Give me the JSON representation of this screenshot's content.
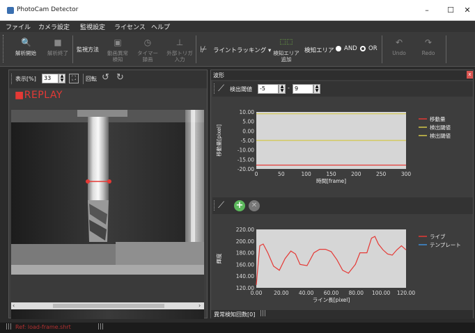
{
  "window": {
    "title": "PhotoCam Detector",
    "minimize": "–",
    "maximize": "☐",
    "close": "✕"
  },
  "menu": [
    "ファイル",
    "カメラ設定",
    "監視設定",
    "ライセンス",
    "ヘルプ"
  ],
  "toolbar": {
    "start_label": "解析開始",
    "stop_label": "解析終了",
    "monitor_method": "監視方法",
    "video_anomaly_l1": "動画異常",
    "video_anomaly_l2": "検知",
    "timer_l1": "タイマー",
    "timer_l2": "録画",
    "ext_trigger_l1": "外部トリガ",
    "ext_trigger_l2": "入力",
    "line_tracking": "ライントラッキング",
    "add_area_l1": "検知エリア",
    "add_area_l2": "追加",
    "detect_area": "検知エリア",
    "and_label": "AND",
    "or_label": "OR",
    "undo": "Undo",
    "redo": "Redo"
  },
  "left_panel": {
    "zoom_label": "表示[%]",
    "zoom_value": "33",
    "rotate_label": "回転",
    "replay_label": "■REPLAY"
  },
  "right_panel": {
    "title": "波形",
    "close": "x",
    "threshold_label": "検出閾値",
    "threshold_low": "-5",
    "threshold_sep": "-",
    "threshold_high": "9",
    "footer": "異常検知回数[0]"
  },
  "status": {
    "text": "Ref: load-frame.shrt"
  },
  "chart_data": [
    {
      "type": "line",
      "xlabel": "時間[frame]",
      "ylabel": "移動量[pixel]",
      "xlim": [
        0,
        300
      ],
      "ylim": [
        -20,
        10
      ],
      "xticks": [
        0,
        50,
        100,
        150,
        200,
        250,
        300
      ],
      "yticks": [
        "10.00",
        "5.00",
        "0.00",
        "-5.00",
        "-10.00",
        "-15.00",
        "-20.00"
      ],
      "series": [
        {
          "name": "移動量",
          "color": "#e53935",
          "x": [
            0,
            300
          ],
          "y": [
            -18,
            -18
          ]
        },
        {
          "name": "検出閾値",
          "color": "#d4c84a",
          "x": [
            0,
            300
          ],
          "y": [
            9,
            9
          ]
        },
        {
          "name": "検出閾値",
          "color": "#d4c84a",
          "x": [
            0,
            300
          ],
          "y": [
            -5,
            -5
          ]
        }
      ]
    },
    {
      "type": "line",
      "xlabel": "ライン長[pixel]",
      "ylabel": "輝度",
      "xlim": [
        0,
        130
      ],
      "ylim": [
        120,
        220
      ],
      "xticks": [
        "0.00",
        "20.00",
        "40.00",
        "60.00",
        "80.00",
        "100.00",
        "120.00"
      ],
      "yticks": [
        "220.00",
        "200.00",
        "180.00",
        "160.00",
        "140.00",
        "120.00"
      ],
      "series": [
        {
          "name": "ライブ",
          "color": "#e53935",
          "x": [
            0,
            3,
            6,
            10,
            15,
            20,
            25,
            30,
            34,
            38,
            44,
            50,
            55,
            60,
            65,
            70,
            75,
            80,
            86,
            90,
            96,
            100,
            103,
            106,
            110,
            114,
            118,
            122,
            126,
            130
          ],
          "y": [
            125,
            192,
            195,
            180,
            157,
            150,
            170,
            183,
            178,
            160,
            158,
            180,
            186,
            186,
            182,
            168,
            150,
            145,
            160,
            180,
            180,
            205,
            208,
            195,
            185,
            178,
            176,
            185,
            192,
            185
          ]
        },
        {
          "name": "テンプレート",
          "color": "#3f8fd9",
          "x": [],
          "y": []
        }
      ]
    }
  ]
}
